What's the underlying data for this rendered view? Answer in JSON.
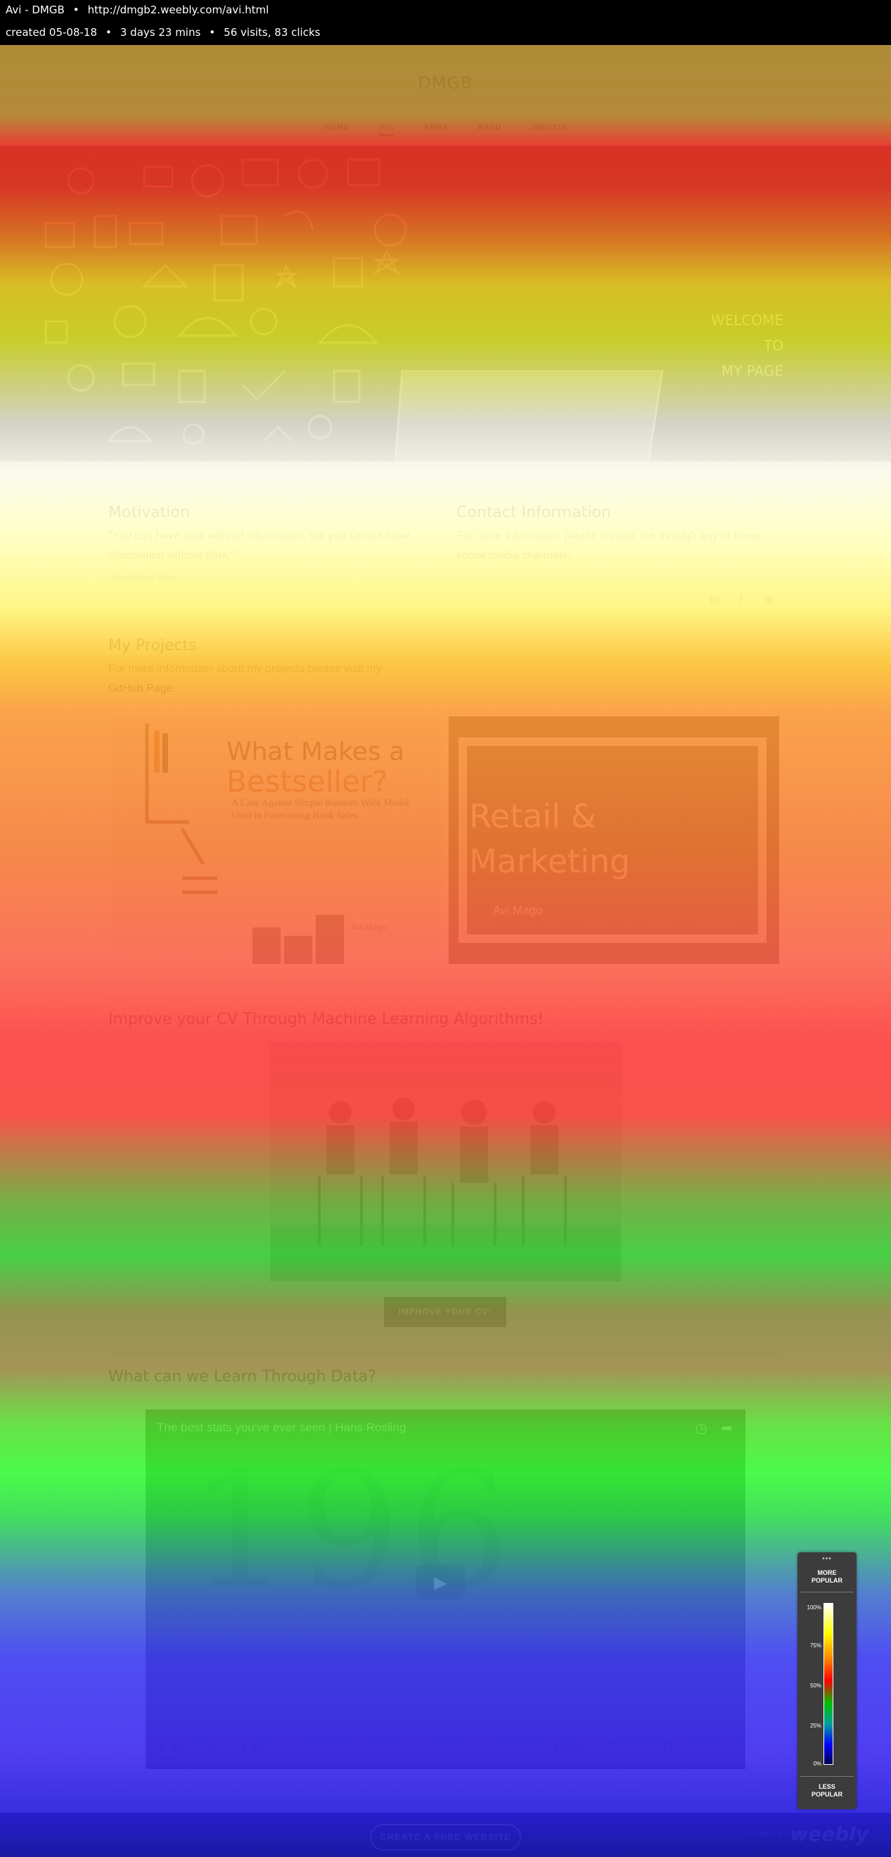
{
  "infobar": {
    "page_title": "Avi - DMGB",
    "url": "http://dmgb2.weebly.com/avi.html",
    "created": "created 05-08-18",
    "duration": "3 days 23 mins",
    "stats": "56 visits, 83 clicks"
  },
  "site": {
    "logo": "DMGB",
    "nav": [
      "HOME",
      "AVI",
      "ANNA",
      "BATU",
      "JINGYIN"
    ],
    "active_nav": "AVI"
  },
  "hero": {
    "welcome_lines": [
      "WELCOME",
      "TO",
      "MY PAGE"
    ]
  },
  "motivation": {
    "title": "Motivation",
    "quote": "\"You can have data without information, but you cannot have information without data.\"",
    "attribution": "- Daniel Keys Moran"
  },
  "contact": {
    "title": "Contact Information",
    "text": "For more information please contact me through any of these social media channels:",
    "icons": [
      "linkedin-icon",
      "facebook-icon",
      "email-icon"
    ]
  },
  "projects": {
    "title": "My Projects",
    "text": "For more information about my projects please visit my",
    "link": "GitHub Page",
    "card1": {
      "line1": "What Makes a",
      "line2": "Bestseller?",
      "subtitle": "A Case Against Simple Random Walk Model Used in Forecasting Book Sales",
      "author": "Avi Mago"
    },
    "card2": {
      "line1": "Retail &",
      "line2": "Marketing",
      "author": "Avi Mago"
    }
  },
  "cv": {
    "title": "Improve your CV Through Machine Learning Algorithms!",
    "button": "IMPROVE YOUR CV!"
  },
  "data_section": {
    "title": "What can we Learn Through Data?",
    "video_title": "The best stats you've ever seen | Hans Rosling",
    "video_big_text": "196",
    "axis_ticks": [
      "2.5",
      "3",
      "3.5",
      "6.5",
      "7",
      "8"
    ]
  },
  "footer": {
    "cta": "CREATE A FREE WEBSITE",
    "powered": "POWERED BY",
    "brand": "weebly"
  },
  "legend": {
    "grip": "•••",
    "more": [
      "MORE",
      "POPULAR"
    ],
    "less": [
      "LESS",
      "POPULAR"
    ],
    "ticks": [
      "100%",
      "75%",
      "50%",
      "25%",
      "0%"
    ]
  },
  "colors": {
    "heat_hot": "#ff0000",
    "heat_warm": "#ffff00",
    "heat_mid": "#00ff00",
    "heat_cold": "#0000ff",
    "infobar_bg": "#000000"
  }
}
